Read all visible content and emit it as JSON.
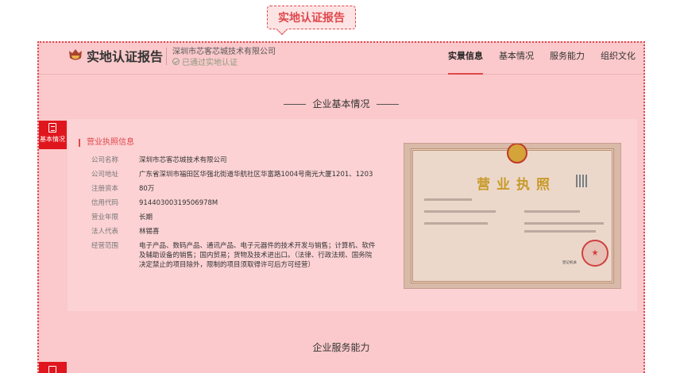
{
  "callout": {
    "label": "实地认证报告"
  },
  "header": {
    "brand": "实地认证报告",
    "company": "深圳市芯客芯城技术有限公司",
    "verified": "已通过实地认证",
    "nav": [
      "实景信息",
      "基本情况",
      "服务能力",
      "组织文化"
    ]
  },
  "side_tab": {
    "label": "基本情况"
  },
  "section_basic": {
    "title": "企业基本情况"
  },
  "section_service": {
    "title": "企业服务能力"
  },
  "license_card": {
    "title": "营业执照信息",
    "rows": [
      {
        "k": "公司名称",
        "v": "深圳市芯客芯城技术有限公司"
      },
      {
        "k": "公司地址",
        "v": "广东省深圳市福田区华强北街道华航社区华富路1004号南光大厦1201、1203"
      },
      {
        "k": "注册资本",
        "v": "80万"
      },
      {
        "k": "信用代码",
        "v": "91440300319506978M"
      },
      {
        "k": "营业年限",
        "v": "长期"
      },
      {
        "k": "法人代表",
        "v": "林锡喜"
      },
      {
        "k": "经营范围",
        "v": "电子产品、数码产品、通讯产品、电子元器件的技术开发与销售；计算机、软件及辅助设备的销售；国内贸易；货物及技术进出口。（法律、行政法规、国务院决定禁止的项目除外，限制的项目须取得许可后方可经营）"
      }
    ],
    "license_image": {
      "title": "营业执照",
      "issuer": "登记机关"
    }
  },
  "colors": {
    "accent": "#e0474c",
    "tab_red": "#e0161e",
    "overlay": "#fbc9cb"
  }
}
